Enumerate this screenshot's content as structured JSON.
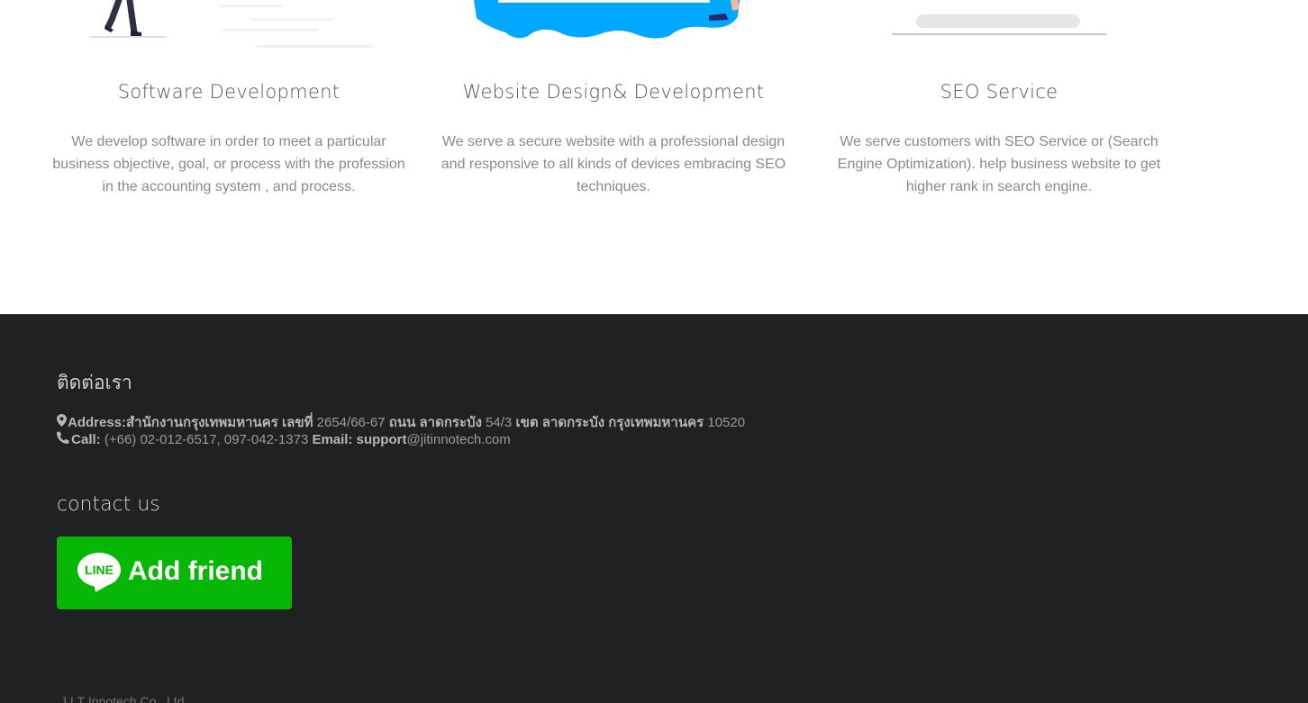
{
  "services": [
    {
      "title": "Software Development",
      "description": "We develop software in order to meet a particular business  objective, goal, or process with the profession in the accounting system , and process.",
      "illustration_icon": "person-walking-icon"
    },
    {
      "title": "Website Design& Development",
      "description": "We serve a secure website with a professional design and responsive to all kinds of devices embracing SEO techniques.",
      "illustration_icon": "web-design-illustration-icon"
    },
    {
      "title": "SEO Service",
      "description": "We serve customers with SEO Service or (Search Engine Optimization). help business website to get higher rank in search engine.",
      "illustration_icon": "search-bar-illustration-icon"
    }
  ],
  "footer": {
    "heading": "ติดต่อเรา",
    "address_label": "Address:",
    "address_text_bold": "สำนักงานกรุงเทพมหานคร เลขที่",
    "address_number": "2654/66-67",
    "address_road_label": "ถนน ลาดกระบัง",
    "address_soi": "54/3",
    "address_district": "เขต ลาดกระบัง กรุงเทพมหานคร",
    "address_postcode": "10520",
    "call_label": "Call:",
    "call_value": "(+66) 02-012-6517, 097-042-1373",
    "email_label": "Email: support",
    "email_value": "@jitinnotech.com",
    "contact_heading": "contact us",
    "line_button_label": "Add friend",
    "line_logo_text": "LINE",
    "copyright": "J.I.T Innotech Co., Ltd."
  },
  "colors": {
    "footer_bg": "#202123",
    "line_green": "#06b705",
    "illustration_blue": "#00a8ff"
  }
}
